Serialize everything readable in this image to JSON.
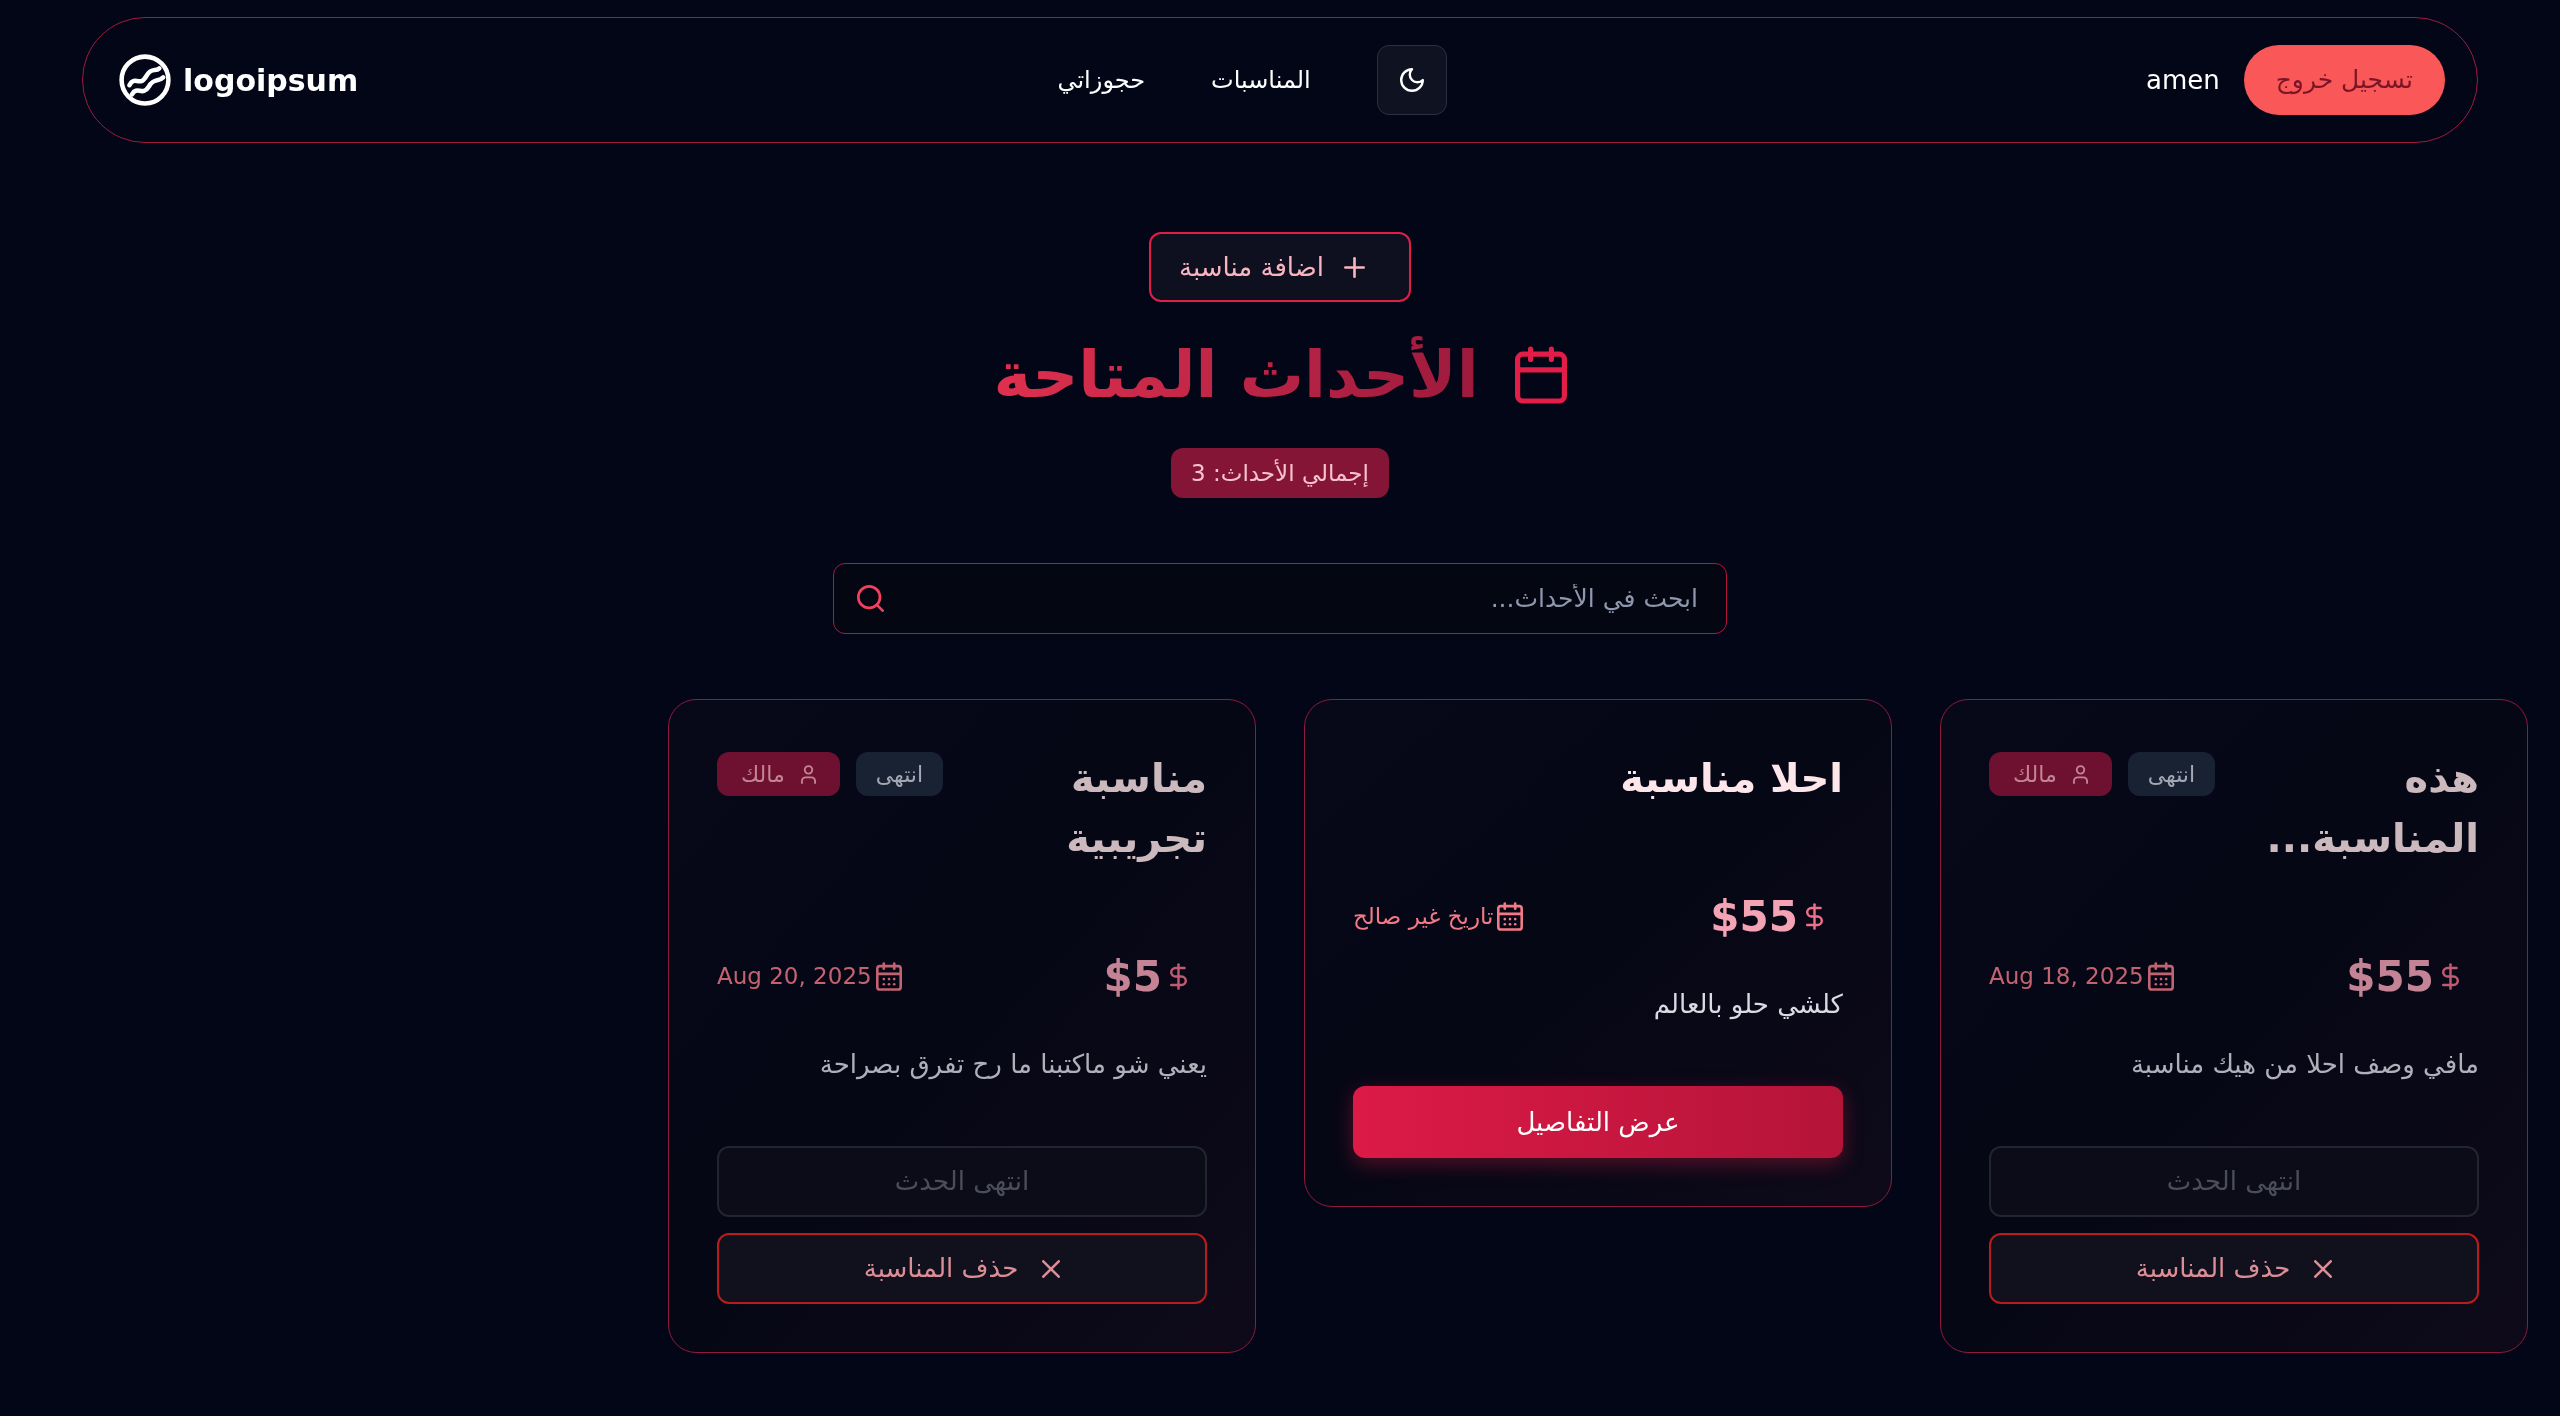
{
  "navbar": {
    "logout_button": "تسجيل خروج",
    "user_name": "amen",
    "links": [
      {
        "label": "المناسبات"
      },
      {
        "label": "حجوزاتي"
      }
    ],
    "logo": "logoipsum"
  },
  "add_button": "اضافة مناسبة",
  "heading": "الأحداث المتاحة",
  "total_badge": "إجمالي الأحداث: 3",
  "search": {
    "placeholder": "ابحث في الأحداث..."
  },
  "events": [
    {
      "title": "هذه المناسبة...",
      "ended": true,
      "badges": [
        {
          "kind": "status",
          "label": "انتهى"
        },
        {
          "kind": "owner",
          "label": "مالك"
        }
      ],
      "price": "$55",
      "date": "Aug 18, 2025",
      "description": "مافي وصف احلا من هيك مناسبة",
      "actions": [
        {
          "kind": "status",
          "label": "انتهى الحدث",
          "disabled": true
        },
        {
          "kind": "delete",
          "label": "حذف المناسبة",
          "disabled": false
        }
      ]
    },
    {
      "title": "احلا مناسبة",
      "ended": false,
      "price": "$55",
      "date": "تاريخ غير صالح",
      "description": "كلشي حلو بالعالم",
      "actions": [
        {
          "kind": "details",
          "label": "عرض التفاصيل",
          "disabled": false
        }
      ]
    },
    {
      "title": "مناسبة تجريبية",
      "ended": true,
      "badges": [
        {
          "kind": "status",
          "label": "انتهى"
        },
        {
          "kind": "owner",
          "label": "مالك"
        }
      ],
      "price": "$5",
      "date": "Aug 20, 2025",
      "description": "يعني شو ماكتبنا ما رح تفرق بصراحة",
      "actions": [
        {
          "kind": "status",
          "label": "انتهى الحدث",
          "disabled": true
        },
        {
          "kind": "delete",
          "label": "حذف المناسبة",
          "disabled": false
        }
      ]
    }
  ]
}
